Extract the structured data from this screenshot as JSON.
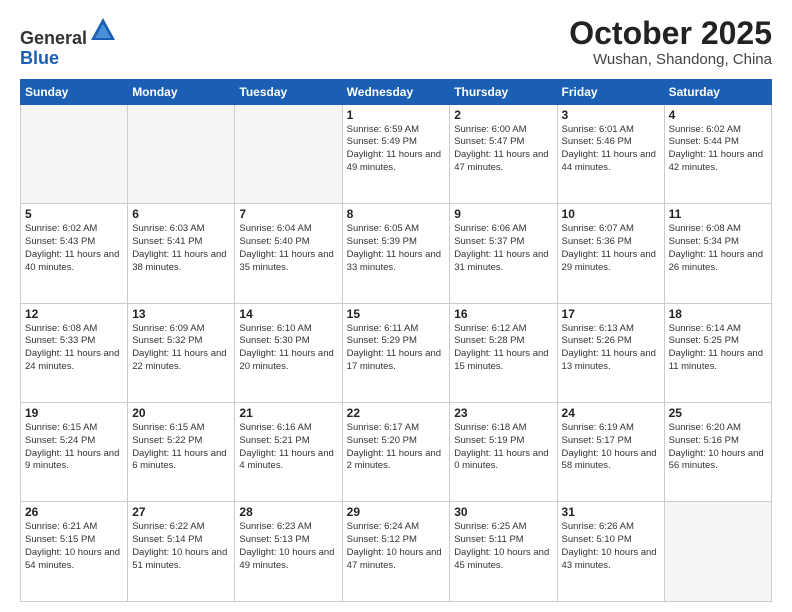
{
  "header": {
    "logo_line1": "General",
    "logo_line2": "Blue",
    "month": "October 2025",
    "location": "Wushan, Shandong, China"
  },
  "weekdays": [
    "Sunday",
    "Monday",
    "Tuesday",
    "Wednesday",
    "Thursday",
    "Friday",
    "Saturday"
  ],
  "weeks": [
    [
      {
        "day": "",
        "empty": true
      },
      {
        "day": "",
        "empty": true
      },
      {
        "day": "",
        "empty": true
      },
      {
        "day": "1",
        "sunrise": "6:59 AM",
        "sunset": "5:49 PM",
        "daylight": "Daylight: 11 hours and 49 minutes."
      },
      {
        "day": "2",
        "sunrise": "6:00 AM",
        "sunset": "5:47 PM",
        "daylight": "Daylight: 11 hours and 47 minutes."
      },
      {
        "day": "3",
        "sunrise": "6:01 AM",
        "sunset": "5:46 PM",
        "daylight": "Daylight: 11 hours and 44 minutes."
      },
      {
        "day": "4",
        "sunrise": "6:02 AM",
        "sunset": "5:44 PM",
        "daylight": "Daylight: 11 hours and 42 minutes."
      }
    ],
    [
      {
        "day": "5",
        "sunrise": "6:02 AM",
        "sunset": "5:43 PM",
        "daylight": "Daylight: 11 hours and 40 minutes."
      },
      {
        "day": "6",
        "sunrise": "6:03 AM",
        "sunset": "5:41 PM",
        "daylight": "Daylight: 11 hours and 38 minutes."
      },
      {
        "day": "7",
        "sunrise": "6:04 AM",
        "sunset": "5:40 PM",
        "daylight": "Daylight: 11 hours and 35 minutes."
      },
      {
        "day": "8",
        "sunrise": "6:05 AM",
        "sunset": "5:39 PM",
        "daylight": "Daylight: 11 hours and 33 minutes."
      },
      {
        "day": "9",
        "sunrise": "6:06 AM",
        "sunset": "5:37 PM",
        "daylight": "Daylight: 11 hours and 31 minutes."
      },
      {
        "day": "10",
        "sunrise": "6:07 AM",
        "sunset": "5:36 PM",
        "daylight": "Daylight: 11 hours and 29 minutes."
      },
      {
        "day": "11",
        "sunrise": "6:08 AM",
        "sunset": "5:34 PM",
        "daylight": "Daylight: 11 hours and 26 minutes."
      }
    ],
    [
      {
        "day": "12",
        "sunrise": "6:08 AM",
        "sunset": "5:33 PM",
        "daylight": "Daylight: 11 hours and 24 minutes."
      },
      {
        "day": "13",
        "sunrise": "6:09 AM",
        "sunset": "5:32 PM",
        "daylight": "Daylight: 11 hours and 22 minutes."
      },
      {
        "day": "14",
        "sunrise": "6:10 AM",
        "sunset": "5:30 PM",
        "daylight": "Daylight: 11 hours and 20 minutes."
      },
      {
        "day": "15",
        "sunrise": "6:11 AM",
        "sunset": "5:29 PM",
        "daylight": "Daylight: 11 hours and 17 minutes."
      },
      {
        "day": "16",
        "sunrise": "6:12 AM",
        "sunset": "5:28 PM",
        "daylight": "Daylight: 11 hours and 15 minutes."
      },
      {
        "day": "17",
        "sunrise": "6:13 AM",
        "sunset": "5:26 PM",
        "daylight": "Daylight: 11 hours and 13 minutes."
      },
      {
        "day": "18",
        "sunrise": "6:14 AM",
        "sunset": "5:25 PM",
        "daylight": "Daylight: 11 hours and 11 minutes."
      }
    ],
    [
      {
        "day": "19",
        "sunrise": "6:15 AM",
        "sunset": "5:24 PM",
        "daylight": "Daylight: 11 hours and 9 minutes."
      },
      {
        "day": "20",
        "sunrise": "6:15 AM",
        "sunset": "5:22 PM",
        "daylight": "Daylight: 11 hours and 6 minutes."
      },
      {
        "day": "21",
        "sunrise": "6:16 AM",
        "sunset": "5:21 PM",
        "daylight": "Daylight: 11 hours and 4 minutes."
      },
      {
        "day": "22",
        "sunrise": "6:17 AM",
        "sunset": "5:20 PM",
        "daylight": "Daylight: 11 hours and 2 minutes."
      },
      {
        "day": "23",
        "sunrise": "6:18 AM",
        "sunset": "5:19 PM",
        "daylight": "Daylight: 11 hours and 0 minutes."
      },
      {
        "day": "24",
        "sunrise": "6:19 AM",
        "sunset": "5:17 PM",
        "daylight": "Daylight: 10 hours and 58 minutes."
      },
      {
        "day": "25",
        "sunrise": "6:20 AM",
        "sunset": "5:16 PM",
        "daylight": "Daylight: 10 hours and 56 minutes."
      }
    ],
    [
      {
        "day": "26",
        "sunrise": "6:21 AM",
        "sunset": "5:15 PM",
        "daylight": "Daylight: 10 hours and 54 minutes."
      },
      {
        "day": "27",
        "sunrise": "6:22 AM",
        "sunset": "5:14 PM",
        "daylight": "Daylight: 10 hours and 51 minutes."
      },
      {
        "day": "28",
        "sunrise": "6:23 AM",
        "sunset": "5:13 PM",
        "daylight": "Daylight: 10 hours and 49 minutes."
      },
      {
        "day": "29",
        "sunrise": "6:24 AM",
        "sunset": "5:12 PM",
        "daylight": "Daylight: 10 hours and 47 minutes."
      },
      {
        "day": "30",
        "sunrise": "6:25 AM",
        "sunset": "5:11 PM",
        "daylight": "Daylight: 10 hours and 45 minutes."
      },
      {
        "day": "31",
        "sunrise": "6:26 AM",
        "sunset": "5:10 PM",
        "daylight": "Daylight: 10 hours and 43 minutes."
      },
      {
        "day": "",
        "empty": true
      }
    ]
  ]
}
